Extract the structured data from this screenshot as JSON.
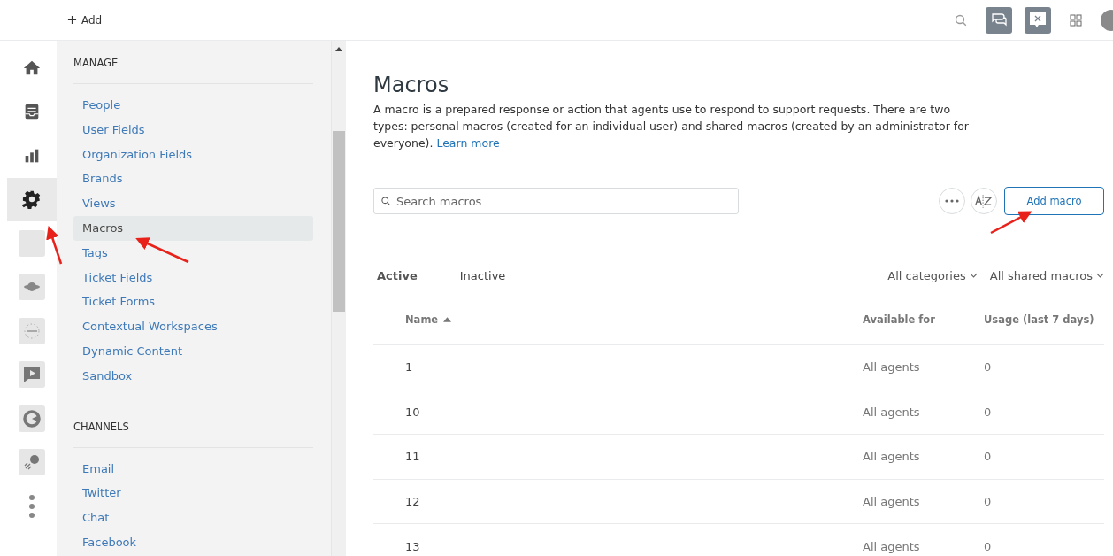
{
  "topbar": {
    "add_label": "Add"
  },
  "rail": [
    {
      "kind": "home",
      "selected": false
    },
    {
      "kind": "inbox",
      "selected": false
    },
    {
      "kind": "chart",
      "selected": false
    },
    {
      "kind": "gear",
      "selected": true
    },
    {
      "kind": "blank",
      "selected": false
    },
    {
      "kind": "planet",
      "selected": false
    },
    {
      "kind": "gdpr",
      "selected": false
    },
    {
      "kind": "video",
      "selected": false
    },
    {
      "kind": "ring",
      "selected": false
    },
    {
      "kind": "comet",
      "selected": false
    },
    {
      "kind": "more",
      "selected": false
    }
  ],
  "sidebar": {
    "sections": [
      {
        "title": "MANAGE",
        "items": [
          {
            "label": "People",
            "selected": false
          },
          {
            "label": "User Fields",
            "selected": false
          },
          {
            "label": "Organization Fields",
            "selected": false
          },
          {
            "label": "Brands",
            "selected": false
          },
          {
            "label": "Views",
            "selected": false
          },
          {
            "label": "Macros",
            "selected": true
          },
          {
            "label": "Tags",
            "selected": false
          },
          {
            "label": "Ticket Fields",
            "selected": false
          },
          {
            "label": "Ticket Forms",
            "selected": false
          },
          {
            "label": "Contextual Workspaces",
            "selected": false
          },
          {
            "label": "Dynamic Content",
            "selected": false
          },
          {
            "label": "Sandbox",
            "selected": false
          }
        ]
      },
      {
        "title": "CHANNELS",
        "items": [
          {
            "label": "Email",
            "selected": false
          },
          {
            "label": "Twitter",
            "selected": false
          },
          {
            "label": "Chat",
            "selected": false
          },
          {
            "label": "Facebook",
            "selected": false
          }
        ]
      }
    ]
  },
  "page": {
    "title": "Macros",
    "description": "A macro is a prepared response or action that agents use to respond to support requests. There are two types: personal macros (created for an individual user) and shared macros (created by an administrator for everyone).",
    "learn_more": "Learn more"
  },
  "search": {
    "placeholder": "Search macros"
  },
  "add_button": "Add macro",
  "tabs": [
    {
      "label": "Active",
      "selected": true
    },
    {
      "label": "Inactive",
      "selected": false
    }
  ],
  "filters": [
    "All categories",
    "All shared macros"
  ],
  "table": {
    "columns": [
      "Name",
      "Available for",
      "Usage (last 7 days)"
    ],
    "rows": [
      [
        "1",
        "All agents",
        "0"
      ],
      [
        "10",
        "All agents",
        "0"
      ],
      [
        "11",
        "All agents",
        "0"
      ],
      [
        "12",
        "All agents",
        "0"
      ],
      [
        "13",
        "All agents",
        "0"
      ]
    ]
  }
}
